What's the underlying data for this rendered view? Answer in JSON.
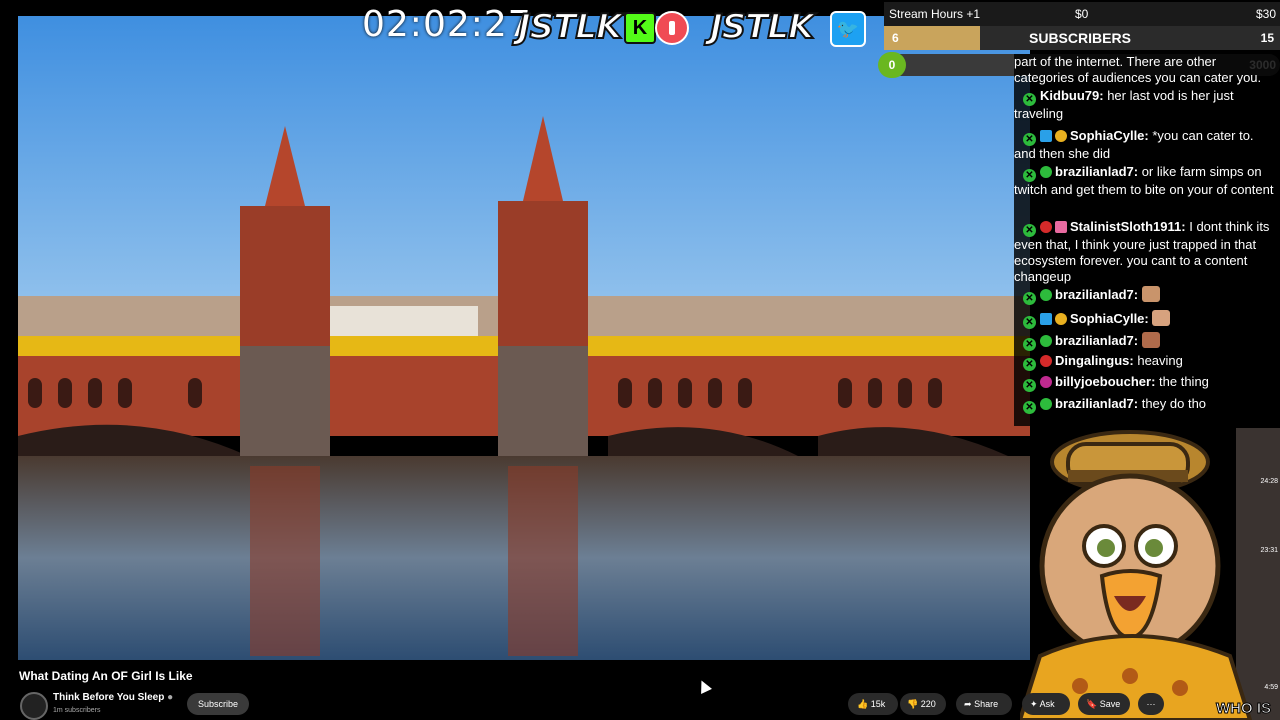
{
  "overlay": {
    "timer": "02:02:27",
    "logo_left": "JSTLK",
    "logo_right": "JSTLK",
    "kick_icon": "kick-icon",
    "twitter_icon": "twitter-icon"
  },
  "goal": {
    "title": "Stream Hours +1",
    "amount_left": "$0",
    "amount_right": "$30",
    "sub_count": "6",
    "sub_label": "SUBSCRIBERS",
    "sub_target": "15",
    "progress_value": "0",
    "progress_target": "3000"
  },
  "chat": {
    "messages": [
      {
        "user": "",
        "text": "part of the internet. There are other categories of audiences you can cater you."
      },
      {
        "user": "Kidbuu79:",
        "text": "her last vod is her just traveling"
      },
      {
        "user": "SophiaCylle:",
        "text": "*you can cater to. and then she did"
      },
      {
        "user": "brazilianlad7:",
        "text": "or like farm simps on twitch and get them to bite on your of content"
      },
      {
        "user": "StalinistSloth1911:",
        "text": "I dont think its even that, I think youre just trapped in that ecosystem forever. you cant to a content changeup"
      },
      {
        "user": "brazilianlad7:",
        "text": ""
      },
      {
        "user": "SophiaCylle:",
        "text": ""
      },
      {
        "user": "brazilianlad7:",
        "text": ""
      },
      {
        "user": "Dingalingus:",
        "text": "heaving"
      },
      {
        "user": "billyjoeboucher:",
        "text": "the thing"
      },
      {
        "user": "brazilianlad7:",
        "text": "they do tho"
      }
    ]
  },
  "webcam": {
    "times": [
      "24:28",
      "23:31",
      "4:59"
    ]
  },
  "video": {
    "title": "What Dating An OF Girl Is Like",
    "channel": "Think Before You Sleep",
    "subscribers": "1m subscribers",
    "subscribe_label": "Subscribe",
    "likes": "15k",
    "dislikes": "220",
    "share_label": "Share",
    "ask_label": "Ask",
    "save_label": "Save",
    "more_label": "···"
  },
  "banner": {
    "text": "WHO IS"
  },
  "colors": {
    "goal_bar": "#c9a45c",
    "progress_bubble": "#6ab720",
    "chat_ban": "#2dbb3c"
  }
}
